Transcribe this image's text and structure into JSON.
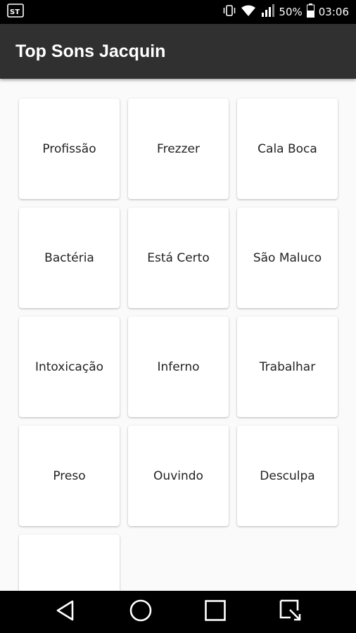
{
  "status_bar": {
    "battery": "50%",
    "time": "03:06",
    "icons": [
      "app-notification-icon",
      "vibrate-icon",
      "wifi-icon",
      "signal-icon",
      "battery-icon"
    ]
  },
  "app_bar": {
    "title": "Top Sons Jacquin"
  },
  "sound_buttons": [
    {
      "label": "Profissão"
    },
    {
      "label": "Frezzer"
    },
    {
      "label": "Cala Boca"
    },
    {
      "label": "Bactéria"
    },
    {
      "label": "Está Certo"
    },
    {
      "label": "São Maluco"
    },
    {
      "label": "Intoxicação"
    },
    {
      "label": "Inferno"
    },
    {
      "label": "Trabalhar"
    },
    {
      "label": "Preso"
    },
    {
      "label": "Ouvindo"
    },
    {
      "label": "Desculpa"
    },
    {
      "label": ""
    }
  ],
  "nav_bar": {
    "icons": [
      "back-icon",
      "home-icon",
      "recents-icon",
      "screenshot-icon"
    ]
  },
  "colors": {
    "app_bar": "#303030",
    "background": "#fafafa",
    "card": "#ffffff"
  }
}
